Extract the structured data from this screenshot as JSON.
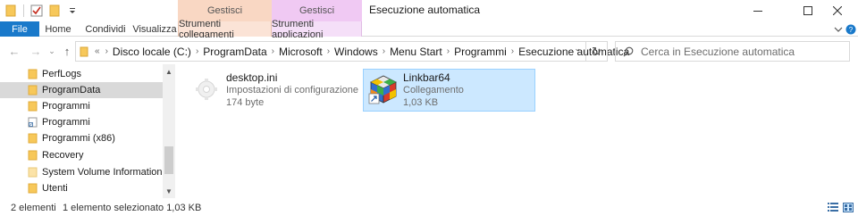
{
  "window": {
    "title": "Esecuzione automatica",
    "context_group_1": "Gestisci",
    "context_group_2": "Gestisci"
  },
  "ribbon": {
    "tabs": [
      "File",
      "Home",
      "Condividi",
      "Visualizza",
      "Strumenti collegamenti",
      "Strumenti applicazioni"
    ]
  },
  "address": {
    "crumbs": [
      "Disco locale (C:)",
      "ProgramData",
      "Microsoft",
      "Windows",
      "Menu Start",
      "Programmi",
      "Esecuzione automatica"
    ],
    "overflow": "«"
  },
  "search": {
    "placeholder": "Cerca in Esecuzione automatica"
  },
  "nav": {
    "items": [
      {
        "label": "PerfLogs",
        "icon": "folder-icon",
        "selected": false
      },
      {
        "label": "ProgramData",
        "icon": "folder-icon",
        "selected": true
      },
      {
        "label": "Programmi",
        "icon": "folder-icon",
        "selected": false
      },
      {
        "label": "Programmi",
        "icon": "shortcut-folder-icon",
        "selected": false
      },
      {
        "label": "Programmi (x86)",
        "icon": "folder-icon",
        "selected": false
      },
      {
        "label": "Recovery",
        "icon": "folder-icon",
        "selected": false
      },
      {
        "label": "System Volume Information",
        "icon": "folder-icon",
        "selected": false
      },
      {
        "label": "Utenti",
        "icon": "folder-icon",
        "selected": false
      }
    ]
  },
  "files": [
    {
      "name": "desktop.ini",
      "type": "Impostazioni di configurazione",
      "size": "174 byte",
      "icon": "settings-file-icon",
      "selected": false
    },
    {
      "name": "Linkbar64",
      "type": "Collegamento",
      "size": "1,03 KB",
      "icon": "rubiks-cube-shortcut-icon",
      "selected": true
    }
  ],
  "status": {
    "count": "2 elementi",
    "selection": "1 elemento selezionato  1,03 KB"
  },
  "colors": {
    "file_tab": "#1979ca",
    "shortcut_tools": "#fbe3d6",
    "app_tools": "#f5dff8",
    "selection": "#cce8ff",
    "folder": "#f7c85a"
  }
}
